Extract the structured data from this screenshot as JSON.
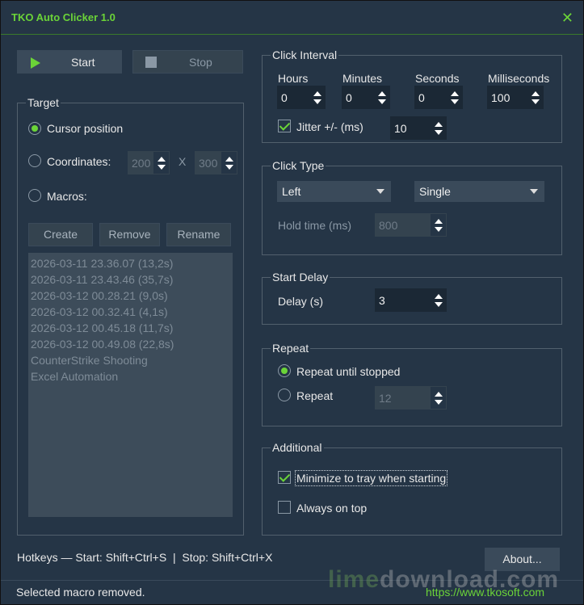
{
  "window": {
    "title": "TKO Auto Clicker 1.0",
    "close_glyph": "✕"
  },
  "toolbar": {
    "start_label": "Start",
    "stop_label": "Stop",
    "start_icon": "play-icon",
    "stop_icon": "stop-icon"
  },
  "target": {
    "label": "Target",
    "cursor_label": "Cursor position",
    "coords_label": "Coordinates:",
    "x_value": "200",
    "x_sep": "X",
    "y_value": "300",
    "macros_label": "Macros:",
    "create_label": "Create",
    "remove_label": "Remove",
    "rename_label": "Rename",
    "selected": "cursor",
    "macros": [
      "2026-03-11 23.36.07 (13,2s)",
      "2026-03-11 23.43.46 (35,7s)",
      "2026-03-12 00.28.21 (9,0s)",
      "2026-03-12 00.32.41 (4,1s)",
      "2026-03-12 00.45.18 (11,7s)",
      "2026-03-12 00.49.08 (22,8s)",
      "CounterStrike Shooting",
      "Excel Automation"
    ]
  },
  "interval": {
    "label": "Click Interval",
    "hours_label": "Hours",
    "hours": "0",
    "minutes_label": "Minutes",
    "minutes": "0",
    "seconds_label": "Seconds",
    "seconds": "0",
    "ms_label": "Milliseconds",
    "ms": "100",
    "jitter_label": "Jitter +/- (ms)",
    "jitter_checked": true,
    "jitter": "10"
  },
  "click_type": {
    "label": "Click Type",
    "button": "Left",
    "mode": "Single",
    "hold_label": "Hold time (ms)",
    "hold": "800"
  },
  "start_delay": {
    "label": "Start Delay",
    "delay_label": "Delay (s)",
    "delay": "3"
  },
  "repeat": {
    "label": "Repeat",
    "until_stopped_label": "Repeat until stopped",
    "repeat_label": "Repeat",
    "count": "12",
    "selected": "until_stopped"
  },
  "additional": {
    "label": "Additional",
    "minimize_label": "Minimize to tray when starting",
    "minimize_checked": true,
    "ontop_label": "Always on top",
    "ontop_checked": false
  },
  "footer": {
    "hotkeys": "Hotkeys — Start: Shift+Ctrl+S  |  Stop: Shift+Ctrl+X",
    "about_label": "About...",
    "status": "Selected macro removed.",
    "url": "https://www.tkosoft.com",
    "watermark_a": "lime",
    "watermark_b": "download.com"
  },
  "colors": {
    "accent": "#6bd438",
    "background": "#253546",
    "control": "#3a4a5a",
    "field": "#1b2835"
  }
}
